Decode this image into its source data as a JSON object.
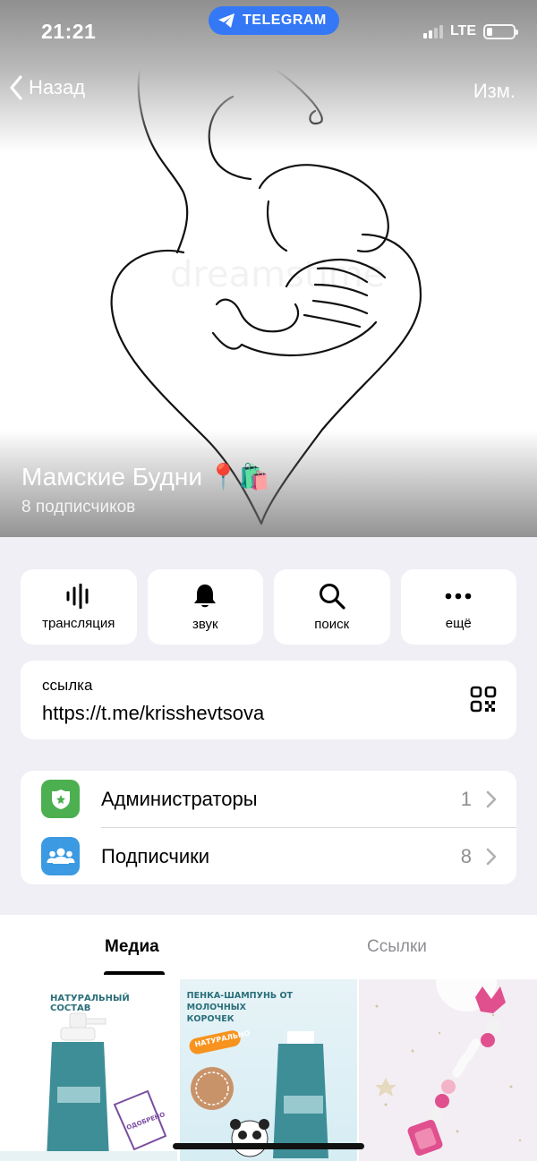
{
  "status_bar": {
    "time": "21:21",
    "network": "LTE",
    "app_pill": "TELEGRAM"
  },
  "nav": {
    "back_label": "Назад",
    "edit_label": "Изм."
  },
  "channel": {
    "name": "Мамские Будни",
    "emoji": "📍🛍️",
    "subscribers_text": "8 подписчиков"
  },
  "actions": [
    {
      "label": "трансляция",
      "icon": "broadcast-icon"
    },
    {
      "label": "звук",
      "icon": "bell-icon"
    },
    {
      "label": "поиск",
      "icon": "search-icon"
    },
    {
      "label": "ещё",
      "icon": "more-icon"
    }
  ],
  "link": {
    "caption": "ссылка",
    "url": "https://t.me/krisshevtsova",
    "icon": "qr-code-icon"
  },
  "management": [
    {
      "label": "Администраторы",
      "count": "1",
      "icon": "shield-icon",
      "color": "#4caf50"
    },
    {
      "label": "Подписчики",
      "count": "8",
      "icon": "people-icon",
      "color": "#3b9ae1"
    }
  ],
  "tabs": [
    {
      "label": "Медиа",
      "active": true
    },
    {
      "label": "Ссылки",
      "active": false
    }
  ],
  "media": {
    "tile1_text": "НАТУРАЛЬНЫЙ СОСТАВ",
    "tile2_text": "ПЕНКА-ШАМПУНЬ ОТ МОЛОЧНЫХ КОРОЧЕК",
    "tile2_badge": "НАТУРАЛЬНО"
  },
  "colors": {
    "accent": "#3478f6",
    "background": "#f0eff5"
  }
}
